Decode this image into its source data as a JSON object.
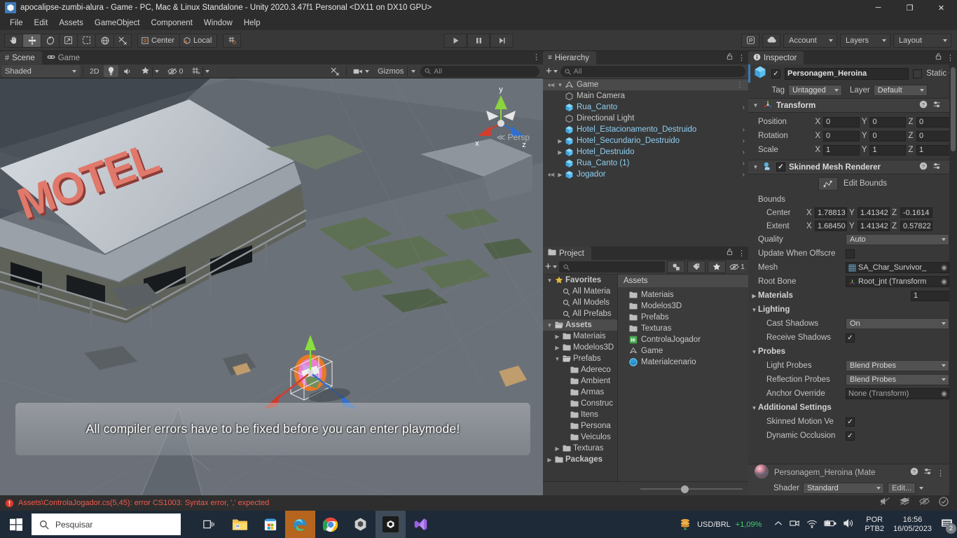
{
  "window": {
    "title": "apocalipse-zumbi-alura - Game - PC, Mac & Linux Standalone - Unity 2020.3.47f1 Personal <DX11 on DX10 GPU>",
    "minimize": "─",
    "maximize": "❐",
    "close": "✕"
  },
  "menubar": {
    "items": [
      "File",
      "Edit",
      "Assets",
      "GameObject",
      "Component",
      "Window",
      "Help"
    ]
  },
  "toolbar": {
    "tools": [
      {
        "name": "hand-tool",
        "glyph": "✋",
        "active": false
      },
      {
        "name": "move-tool",
        "glyph": "✥",
        "active": true
      },
      {
        "name": "rotate-tool",
        "glyph": "↻",
        "active": false
      },
      {
        "name": "scale-tool",
        "glyph": "⤡",
        "active": false
      },
      {
        "name": "rect-tool",
        "glyph": "⬚",
        "active": false
      },
      {
        "name": "transform-tool",
        "glyph": "⊕",
        "active": false
      },
      {
        "name": "custom-tool",
        "glyph": "⚒",
        "active": false
      }
    ],
    "pivot_mode": "Center",
    "pivot_rotation": "Local",
    "grid_snap": "⌗",
    "play": "▶",
    "pause": "❙❙",
    "step": "▶❘",
    "collab_icon": "Ⓟ",
    "cloud_icon": "☁",
    "account": "Account",
    "layers": "Layers",
    "layout": "Layout"
  },
  "scene_panel": {
    "tabs": [
      {
        "label": "Scene",
        "icon": "#",
        "active": true
      },
      {
        "label": "Game",
        "icon": "◑",
        "active": false
      }
    ],
    "draw_mode": "Shaded",
    "mode_2d": "2D",
    "lighting_icon": "Ὂ1",
    "audio_icon": "ὐA",
    "fx_icon": "❖",
    "hidden_count": "0",
    "grid_icon": "⌗",
    "tools_icon": "⚒",
    "camera_icon": "■",
    "gizmos": "Gizmos",
    "search_placeholder": "All",
    "overlay_message": "All compiler errors have to be fixed before you can enter playmode!",
    "gizmo_axes": {
      "x": "x",
      "y": "y",
      "z": "z",
      "projection": "Persp"
    },
    "motel_sign": "MOTEL"
  },
  "hierarchy": {
    "title": "Hierarchy",
    "lock_icon": "⚿",
    "menu_icon": "⋮",
    "add_button": "+",
    "search_placeholder": "All",
    "items": [
      {
        "label": "Game",
        "depth": 0,
        "type": "scene",
        "expanded": true,
        "selected": true,
        "has_children": true,
        "chevron": false
      },
      {
        "label": "Main Camera",
        "depth": 1,
        "type": "gameobject",
        "prefab": false,
        "chevron": false
      },
      {
        "label": "Rua_Canto",
        "depth": 1,
        "type": "prefab",
        "prefab": true,
        "chevron": true
      },
      {
        "label": "Directional Light",
        "depth": 1,
        "type": "gameobject",
        "prefab": false,
        "chevron": false
      },
      {
        "label": "Hotel_Estacionamento_Destruido",
        "depth": 1,
        "type": "prefab",
        "prefab": true,
        "chevron": true
      },
      {
        "label": "Hotel_Secundario_Destruido",
        "depth": 1,
        "type": "prefab",
        "prefab": true,
        "expandable": true,
        "chevron": true
      },
      {
        "label": "Hotel_Destruido",
        "depth": 1,
        "type": "prefab",
        "prefab": true,
        "expandable": true,
        "chevron": true
      },
      {
        "label": "Rua_Canto (1)",
        "depth": 1,
        "type": "prefab",
        "prefab": true,
        "chevron": true
      },
      {
        "label": "Jogador",
        "depth": 1,
        "type": "prefab",
        "prefab": true,
        "expandable": true,
        "chevron": true
      }
    ]
  },
  "project": {
    "title": "Project",
    "lock_icon": "⚿",
    "menu_icon": "⋮",
    "add_button": "+",
    "search_placeholder": "",
    "hidden_packages_count": "1",
    "tree": [
      {
        "label": "Favorites",
        "depth": 0,
        "icon": "star",
        "expanded": true,
        "bold": true
      },
      {
        "label": "All Materia",
        "depth": 1,
        "icon": "search"
      },
      {
        "label": "All Models",
        "depth": 1,
        "icon": "search"
      },
      {
        "label": "All Prefabs",
        "depth": 1,
        "icon": "search"
      },
      {
        "label": "Assets",
        "depth": 0,
        "icon": "folder-open",
        "expanded": true,
        "bold": true,
        "selected": true
      },
      {
        "label": "Materiais",
        "depth": 1,
        "icon": "folder",
        "collapsed": true
      },
      {
        "label": "Modelos3D",
        "depth": 1,
        "icon": "folder",
        "collapsed": true
      },
      {
        "label": "Prefabs",
        "depth": 1,
        "icon": "folder-open",
        "expanded": true
      },
      {
        "label": "Adereco",
        "depth": 2,
        "icon": "folder"
      },
      {
        "label": "Ambient",
        "depth": 2,
        "icon": "folder"
      },
      {
        "label": "Armas",
        "depth": 2,
        "icon": "folder"
      },
      {
        "label": "Construc",
        "depth": 2,
        "icon": "folder"
      },
      {
        "label": "Itens",
        "depth": 2,
        "icon": "folder"
      },
      {
        "label": "Persona",
        "depth": 2,
        "icon": "folder"
      },
      {
        "label": "Veiculos",
        "depth": 2,
        "icon": "folder"
      },
      {
        "label": "Texturas",
        "depth": 1,
        "icon": "folder",
        "collapsed": true
      },
      {
        "label": "Packages",
        "depth": 0,
        "icon": "folder",
        "collapsed": true,
        "bold": true
      }
    ],
    "breadcrumb": "Assets",
    "assets": [
      {
        "label": "Materiais",
        "icon": "folder"
      },
      {
        "label": "Modelos3D",
        "icon": "folder"
      },
      {
        "label": "Prefabs",
        "icon": "folder"
      },
      {
        "label": "Texturas",
        "icon": "folder"
      },
      {
        "label": "ControlaJogador",
        "icon": "script"
      },
      {
        "label": "Game",
        "icon": "scene"
      },
      {
        "label": "Materialcenario",
        "icon": "material"
      }
    ]
  },
  "inspector": {
    "title": "Inspector",
    "lock_icon": "⚿",
    "menu_icon": "⋮",
    "object_name": "Personagem_Heroina",
    "enabled": true,
    "static_label": "Static",
    "tag_label": "Tag",
    "tag_value": "Untagged",
    "layer_label": "Layer",
    "layer_value": "Default",
    "transform": {
      "title": "Transform",
      "rows": [
        {
          "label": "Position",
          "x": "0",
          "y": "0",
          "z": "0"
        },
        {
          "label": "Rotation",
          "x": "0",
          "y": "0",
          "z": "0"
        },
        {
          "label": "Scale",
          "x": "1",
          "y": "1",
          "z": "1"
        }
      ]
    },
    "skinned_mesh_renderer": {
      "title": "Skinned Mesh Renderer",
      "enabled": true,
      "edit_bounds": "Edit Bounds",
      "bounds_label": "Bounds",
      "center": {
        "label": "Center",
        "x": "1.78813",
        "y": "1.41342",
        "z": "-0.1614"
      },
      "extent": {
        "label": "Extent",
        "x": "1.68450",
        "y": "1.41342",
        "z": "0.57822"
      },
      "quality_label": "Quality",
      "quality_value": "Auto",
      "update_offscreen_label": "Update When Offscre",
      "update_offscreen_checked": false,
      "mesh_label": "Mesh",
      "mesh_value": "SA_Char_Survivor_",
      "root_bone_label": "Root Bone",
      "root_bone_value": "Root_jnt (Transform",
      "materials_label": "Materials",
      "materials_count": "1",
      "lighting_label": "Lighting",
      "cast_shadows_label": "Cast Shadows",
      "cast_shadows_value": "On",
      "receive_shadows_label": "Receive Shadows",
      "receive_shadows_checked": true,
      "probes_label": "Probes",
      "light_probes_label": "Light Probes",
      "light_probes_value": "Blend Probes",
      "reflection_probes_label": "Reflection Probes",
      "reflection_probes_value": "Blend Probes",
      "anchor_override_label": "Anchor Override",
      "anchor_override_value": "None (Transform)",
      "additional_settings_label": "Additional Settings",
      "skinned_motion_label": "Skinned Motion Ve",
      "skinned_motion_checked": true,
      "dynamic_occlusion_label": "Dynamic Occlusion",
      "dynamic_occlusion_checked": true
    },
    "material": {
      "title": "Personagem_Heroina (Mate",
      "shader_label": "Shader",
      "shader_value": "Standard",
      "edit_label": "Edit..."
    }
  },
  "status_bar": {
    "error_icon": "!",
    "error_text": "Assets\\ControlaJogador.cs(5,45): error CS1003: Syntax error, ',' expected",
    "right_icons": [
      "mute-audio-icon",
      "layers-off-icon",
      "visibility-off-icon",
      "ready-check-icon"
    ]
  },
  "taskbar": {
    "start_label": "start-button",
    "search_placeholder": "Pesquisar",
    "apps": [
      {
        "name": "task-view-icon"
      },
      {
        "name": "file-explorer-icon"
      },
      {
        "name": "microsoft-store-icon"
      },
      {
        "name": "edge-icon",
        "active": true
      },
      {
        "name": "chrome-icon",
        "running": true
      },
      {
        "name": "unity-hub-icon",
        "running": true
      },
      {
        "name": "unity-editor-icon",
        "active": true,
        "running": true
      },
      {
        "name": "visual-studio-icon",
        "running": true
      }
    ],
    "stocks_label": "USD/BRL",
    "stocks_change": "+1,09%",
    "tray_icons": [
      "chevron-up-icon",
      "onedrive-icon",
      "wifi-icon",
      "battery-icon",
      "volume-icon"
    ],
    "language_line1": "POR",
    "language_line2": "PTB2",
    "time": "16:56",
    "date": "16/05/2023",
    "notification_count": "2"
  },
  "colors": {
    "accent_blue": "#8fd0f2",
    "error_red": "#f05a4f",
    "panel_bg": "#383838",
    "toolbar_bg": "#3c3c3c",
    "taskbar_bg": "#1e2a38",
    "positive_green": "#3fd46a"
  }
}
